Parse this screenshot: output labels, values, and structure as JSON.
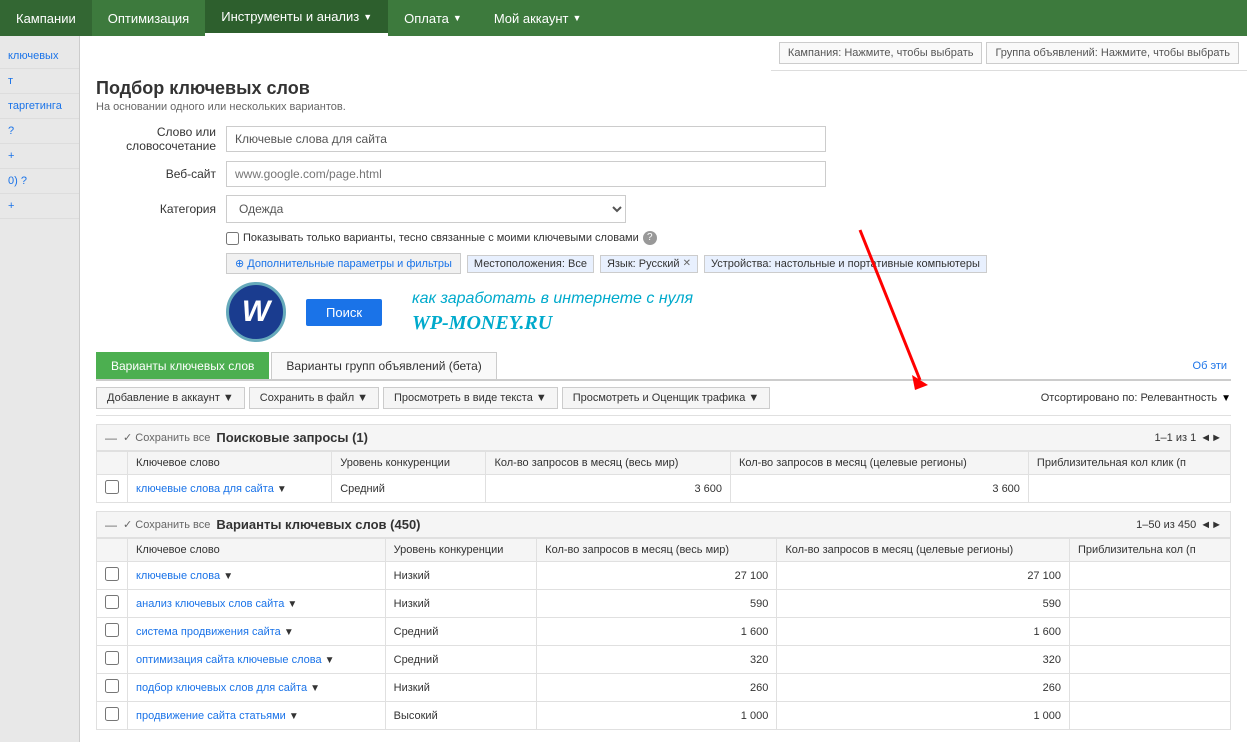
{
  "nav": {
    "items": [
      {
        "label": "Кампании",
        "active": false
      },
      {
        "label": "Оптимизация",
        "active": false
      },
      {
        "label": "Инструменты и анализ",
        "active": true,
        "hasArrow": true
      },
      {
        "label": "Оплата",
        "active": false,
        "hasArrow": true
      },
      {
        "label": "Мой аккаунт",
        "active": false,
        "hasArrow": true
      }
    ]
  },
  "sidebar": {
    "items": [
      {
        "label": "ключевых"
      },
      {
        "label": "т"
      },
      {
        "label": "таргетинга"
      },
      {
        "label": "?"
      },
      {
        "label": "+"
      },
      {
        "label": "0) ?"
      },
      {
        "label": "+"
      }
    ]
  },
  "page": {
    "title": "Подбор ключевых слов",
    "subtitle": "На основании одного или нескольких вариантов."
  },
  "campaign_selector": {
    "label": "Кампания: Нажмите, чтобы выбрать"
  },
  "adgroup_selector": {
    "label": "Группа объявлений: Нажмите, чтобы выбрать"
  },
  "form": {
    "word_label": "Слово или\nсловосочетание",
    "word_value": "Ключевые слова для сайта",
    "website_label": "Веб-сайт",
    "website_placeholder": "www.google.com/page.html",
    "category_label": "Категория",
    "category_value": "Одежда",
    "checkbox_label": "Показывать только варианты, тесно связанные с моими ключевыми словами",
    "filter_btn": "Дополнительные параметры и фильтры",
    "location_tag": "Местоположения: Все",
    "language_tag": "Язык: Русский",
    "device_tag": "Устройства: настольные и портативные компьютеры",
    "search_btn": "Поиск",
    "watermark1": "как заработать в интернете с нуля",
    "watermark2": "WP-MONEY.RU"
  },
  "tabs": {
    "tab1": "Варианты ключевых слов",
    "tab2": "Варианты групп объявлений (бета)",
    "about_link": "Об эти"
  },
  "toolbar": {
    "add_btn": "Добавление в аккаунт",
    "save_btn": "Сохранить в файл",
    "preview_btn": "Просмотреть в виде текста",
    "estimate_btn": "Просмотреть и Оценщик трафика",
    "sort_label": "Отсортировано по: Релевантность"
  },
  "search_table": {
    "title": "Поисковые запросы (1)",
    "save_all": "✓ Сохранить все",
    "pagination": "1–1 из 1",
    "columns": [
      "Ключевое слово",
      "Уровень конкуренции",
      "Кол-во запросов в месяц (весь мир)",
      "Кол-во запросов в месяц (целевые регионы)",
      "Приблизительная кол клик (п"
    ],
    "rows": [
      {
        "keyword": "ключевые слова для сайта",
        "competition": "Средний",
        "global_monthly": "3 600",
        "local_monthly": "3 600",
        "cpc": ""
      }
    ]
  },
  "variants_table": {
    "title": "Варианты ключевых слов (450)",
    "save_all": "✓ Сохранить все",
    "pagination": "1–50 из 450",
    "columns": [
      "Ключевое слово",
      "Уровень конкуренции",
      "Кол-во запросов в месяц (весь мир)",
      "Кол-во запросов в месяц (целевые регионы)",
      "Приблизительна кол (п"
    ],
    "rows": [
      {
        "keyword": "ключевые слова",
        "competition": "Низкий",
        "global_monthly": "27 100",
        "local_monthly": "27 100",
        "cpc": ""
      },
      {
        "keyword": "анализ ключевых слов сайта",
        "competition": "Низкий",
        "global_monthly": "590",
        "local_monthly": "590",
        "cpc": ""
      },
      {
        "keyword": "система продвижения сайта",
        "competition": "Средний",
        "global_monthly": "1 600",
        "local_monthly": "1 600",
        "cpc": ""
      },
      {
        "keyword": "оптимизация сайта ключевые слова",
        "competition": "Средний",
        "global_monthly": "320",
        "local_monthly": "320",
        "cpc": ""
      },
      {
        "keyword": "подбор ключевых слов для сайта",
        "competition": "Низкий",
        "global_monthly": "260",
        "local_monthly": "260",
        "cpc": ""
      },
      {
        "keyword": "продвижение сайта статьями",
        "competition": "Высокий",
        "global_monthly": "1 000",
        "local_monthly": "1 000",
        "cpc": ""
      }
    ]
  },
  "icons": {
    "arrow_down": "▼",
    "arrow_right": "▶",
    "collapse": "—",
    "check": "✓",
    "close": "✕",
    "question": "?",
    "plus": "+",
    "page_nav": "◄►"
  }
}
